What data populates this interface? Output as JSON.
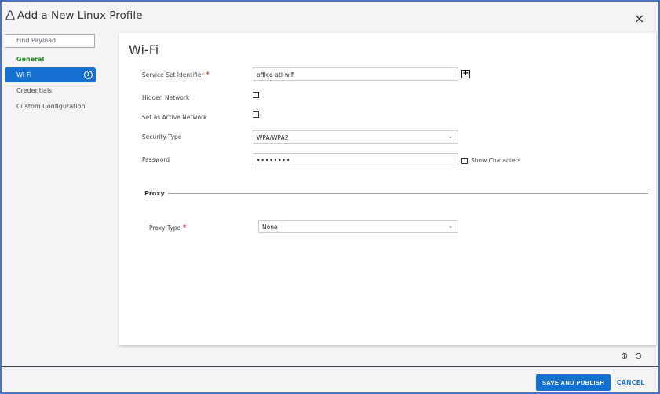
{
  "header": {
    "title": "Add a New Linux Profile",
    "close": "×"
  },
  "sidebar": {
    "search_placeholder": "Find Payload",
    "items": [
      {
        "label": "General"
      },
      {
        "label": "Wi-Fi",
        "badge": "1"
      },
      {
        "label": "Credentials"
      },
      {
        "label": "Custom Configuration"
      }
    ]
  },
  "form": {
    "title": "Wi-Fi",
    "ssid_label": "Service Set Identifier",
    "ssid_value": "office-atl-wifi",
    "hidden_label": "Hidden Network",
    "hidden_checked": false,
    "active_label": "Set as Active Network",
    "active_checked": false,
    "security_label": "Security Type",
    "security_value": "WPA/WPA2",
    "password_label": "Password",
    "password_value": "••••••••",
    "show_chars_label": "Show Characters",
    "proxy_section": "Proxy",
    "proxy_type_label": "Proxy Type",
    "proxy_type_value": "None",
    "required_mark": "*"
  },
  "footer": {
    "save": "SAVE AND PUBLISH",
    "cancel": "CANCEL"
  }
}
